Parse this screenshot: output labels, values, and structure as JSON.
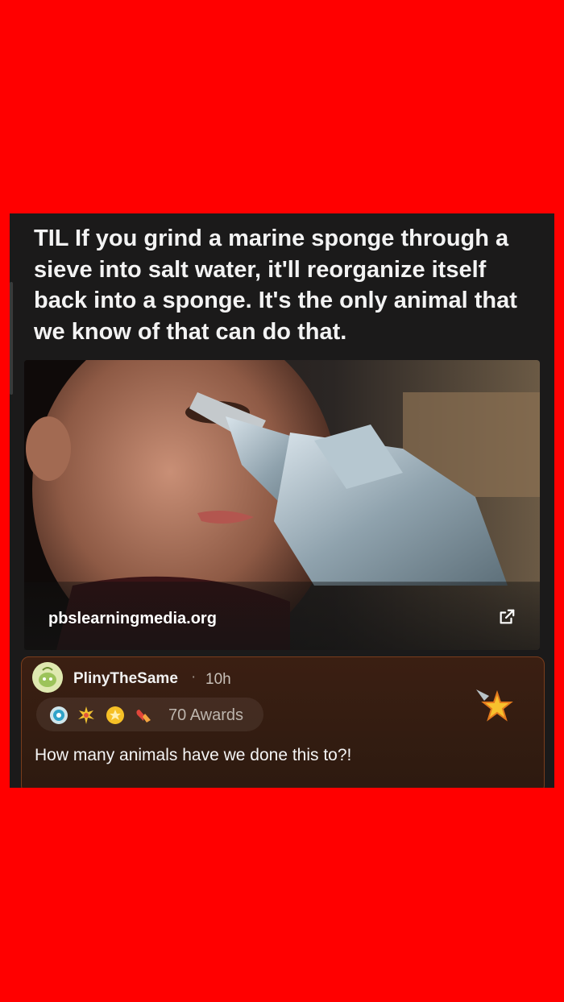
{
  "post": {
    "title": "TIL If you grind a marine sponge through a sieve into salt water, it'll reorganize itself back into a sponge. It's the only animal that we know of that can do that.",
    "link_domain": "pbslearningmedia.org"
  },
  "comment": {
    "username": "PlinyTheSame",
    "separator": "·",
    "time": "10h",
    "awards_label": "70 Awards",
    "body": "How many animals have we done this to?!"
  },
  "colors": {
    "background": "#ff0000",
    "card": "#1b1a1a",
    "comment_border": "#7a3d1c"
  }
}
